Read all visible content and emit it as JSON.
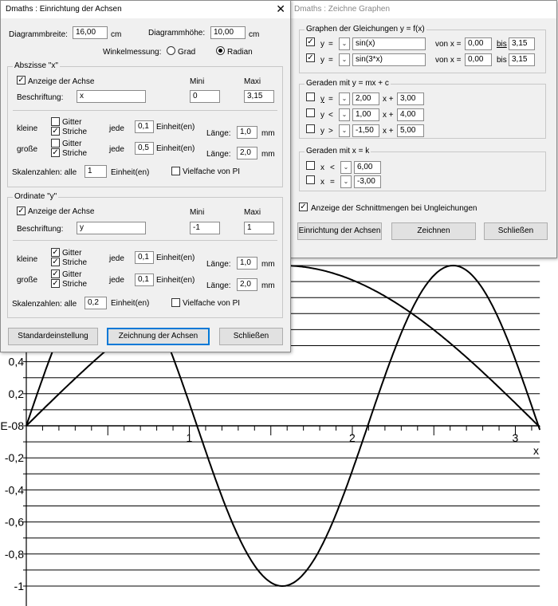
{
  "plot": {
    "x_ticks": [
      "1",
      "2",
      "3"
    ],
    "y_ticks": [
      "0,4",
      "0,2",
      "E-08",
      "-0,2",
      "-0,4",
      "-0,6",
      "-0,8",
      "-1"
    ],
    "x_axis_label": "x"
  },
  "chart_data": {
    "type": "line",
    "series": [
      {
        "expr": "sin(x)",
        "x": [
          0,
          0.5,
          1,
          1.57,
          2,
          2.5,
          3,
          3.15
        ],
        "y": [
          0,
          0.479,
          0.841,
          1,
          0.909,
          0.598,
          0.141,
          -0.008
        ]
      },
      {
        "expr": "sin(3*x)",
        "x": [
          0,
          0.25,
          0.52,
          1,
          1.5,
          2,
          2.5,
          2.62,
          3,
          3.15
        ],
        "y": [
          0,
          0.682,
          1,
          0.141,
          -0.978,
          -0.279,
          0.938,
          1,
          0.412,
          -0.025
        ]
      }
    ],
    "xlim": [
      0,
      3.15
    ],
    "ylim": [
      -1,
      1
    ],
    "grid": true
  },
  "axes_dialog": {
    "title": "Dmaths : Einrichtung der Achsen",
    "diagram_width_label": "Diagrammbreite:",
    "diagram_width_value": "16,00",
    "diagram_width_unit": "cm",
    "diagram_height_label": "Diagrammhöhe:",
    "diagram_height_value": "10,00",
    "diagram_height_unit": "cm",
    "angle_label": "Winkelmessung:",
    "angle_grad": "Grad",
    "angle_radian": "Radian",
    "abscissa": {
      "legend": "Abszisse \"x\"",
      "show_axis": "Anzeige der Achse",
      "mini_label": "Mini",
      "maxi_label": "Maxi",
      "caption_label": "Beschriftung:",
      "caption_value": "x",
      "mini_value": "0",
      "maxi_value": "3,15",
      "small_label": "kleine",
      "large_label": "große",
      "grid_label": "Gitter",
      "ticks_label": "Striche",
      "each_label": "jede",
      "small_step": "0,1",
      "large_step": "0,5",
      "unit_label": "Einheit(en)",
      "length_label": "Länge:",
      "small_length": "1,0",
      "large_length": "2,0",
      "mm": "mm",
      "scale_label": "Skalenzahlen: alle",
      "scale_value": "1",
      "scale_unit": "Einheit(en)",
      "pi_multiples": "Vielfache von  PI"
    },
    "ordinate": {
      "legend": "Ordinate \"y\"",
      "show_axis": "Anzeige der Achse",
      "mini_label": "Mini",
      "maxi_label": "Maxi",
      "caption_label": "Beschriftung:",
      "caption_value": "y",
      "mini_value": "-1",
      "maxi_value": "1",
      "small_label": "kleine",
      "large_label": "große",
      "grid_label": "Gitter",
      "ticks_label": "Striche",
      "each_label": "jede",
      "small_step": "0,1",
      "large_step": "0,1",
      "unit_label": "Einheit(en)",
      "length_label": "Länge:",
      "small_length": "1,0",
      "large_length": "2,0",
      "mm": "mm",
      "scale_label": "Skalenzahlen: alle",
      "scale_value": "0,2",
      "scale_unit": "Einheit(en)",
      "pi_multiples": "Vielfache von PI"
    },
    "btn_default": "Standardeinstellung",
    "btn_draw_axes": "Zeichnung der Achsen",
    "btn_close": "Schließen"
  },
  "graph_dialog": {
    "title": "Dmaths : Zeichne Graphen",
    "eq_legend": "Graphen der Gleichungen y = f(x)",
    "y_label": "y",
    "eq_op": "=",
    "eq1": "sin(x)",
    "eq2": "sin(3*x)",
    "from_label": "von x =",
    "to_label": "bis",
    "eq1_from": "0,00",
    "eq1_to": "3,15",
    "eq2_from": "0,00",
    "eq2_to": "3,15",
    "lines_legend": "Geraden mit y = mx + c",
    "line_ops": [
      "=",
      "<",
      ">"
    ],
    "line_m": [
      "2,00",
      "1,00",
      "-1,50"
    ],
    "x_plus": "x +",
    "line_c": [
      "3,00",
      "4,00",
      "5,00"
    ],
    "vert_legend": "Geraden mit x = k",
    "x_label": "x",
    "vert_ops": [
      "<",
      "="
    ],
    "vert_k": [
      "6,00",
      "-3,00"
    ],
    "intersections": "Anzeige der Schnittmengen bei Ungleichungen",
    "btn_axes": "Einrichtung der Achsen",
    "btn_draw": "Zeichnen",
    "btn_close": "Schließen"
  }
}
